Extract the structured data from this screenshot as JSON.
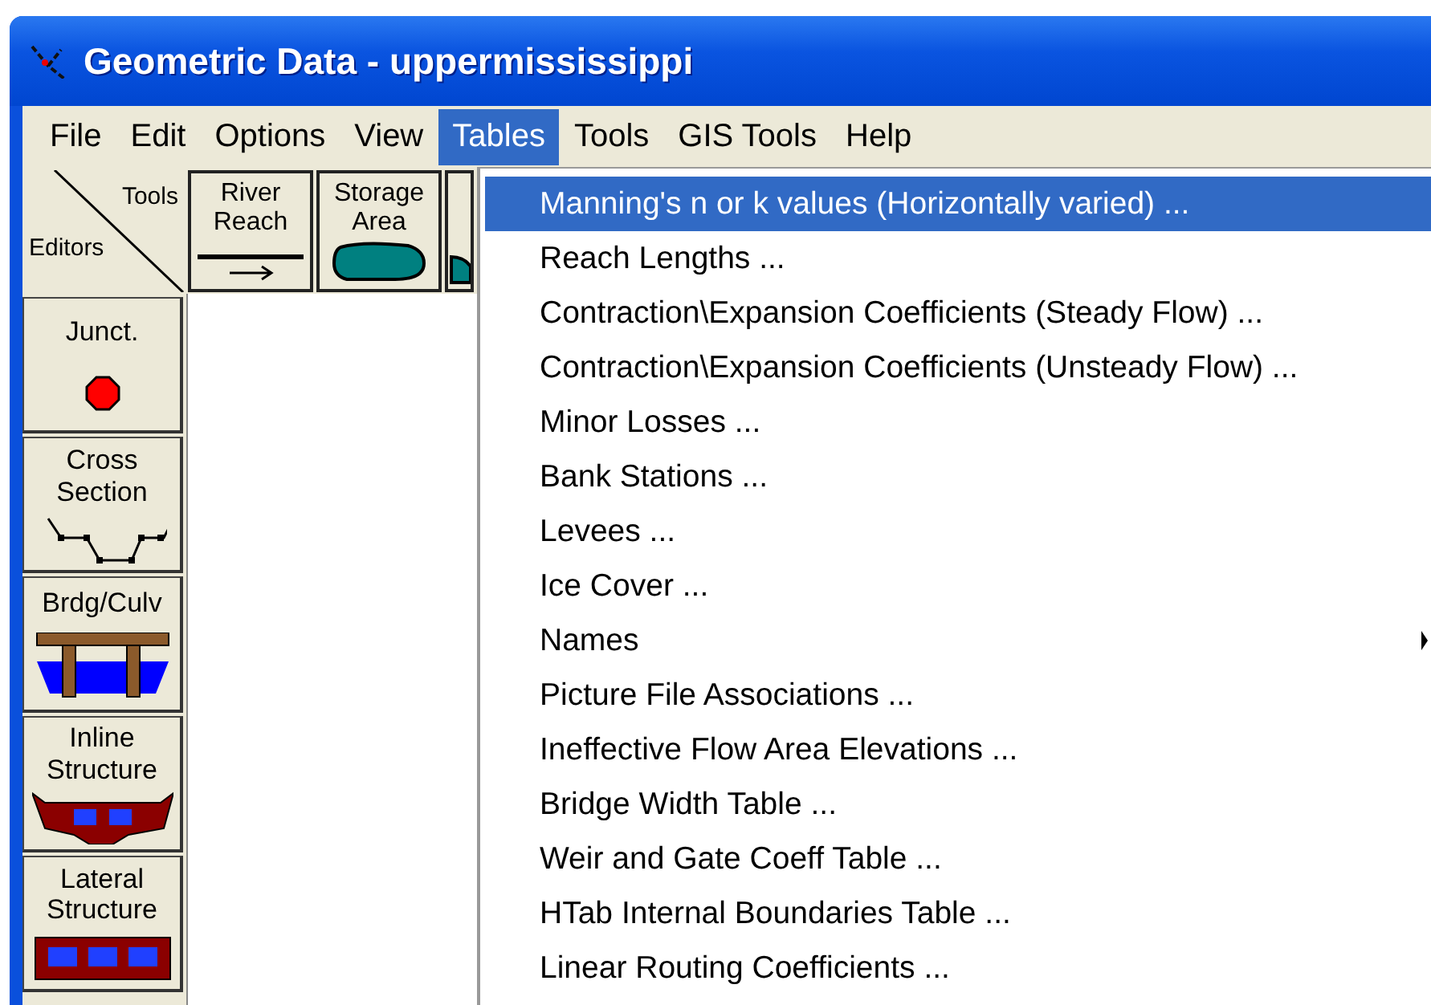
{
  "window": {
    "title": "Geometric Data - uppermississippi"
  },
  "menu_bar": [
    {
      "label": "File",
      "selected": false
    },
    {
      "label": "Edit",
      "selected": false
    },
    {
      "label": "Options",
      "selected": false
    },
    {
      "label": "View",
      "selected": false
    },
    {
      "label": "Tables",
      "selected": true
    },
    {
      "label": "Tools",
      "selected": false
    },
    {
      "label": "GIS Tools",
      "selected": false
    },
    {
      "label": "Help",
      "selected": false
    }
  ],
  "toolbar": {
    "corner": {
      "tools": "Tools",
      "editors": "Editors"
    },
    "tools": [
      {
        "label": "River Reach",
        "kind": "reach"
      },
      {
        "label": "Storage Area",
        "kind": "storage"
      },
      {
        "kind": "partial"
      }
    ]
  },
  "editors": [
    {
      "label": "Junct.",
      "kind": "junction"
    },
    {
      "label": "Cross Section",
      "kind": "cross-section"
    },
    {
      "label": "Brdg/Culv",
      "kind": "bridge"
    },
    {
      "label": "Inline Structure",
      "kind": "inline"
    },
    {
      "label": "Lateral Structure",
      "kind": "lateral"
    }
  ],
  "tables_menu": [
    {
      "label": "Manning's n or k values (Horizontally varied) ...",
      "selected": true
    },
    {
      "label": "Reach Lengths ...",
      "selected": false
    },
    {
      "label": "Contraction\\Expansion Coefficients (Steady Flow) ...",
      "selected": false
    },
    {
      "label": "Contraction\\Expansion Coefficients (Unsteady Flow) ...",
      "selected": false
    },
    {
      "label": "Minor Losses ...",
      "selected": false
    },
    {
      "label": "Bank Stations ...",
      "selected": false
    },
    {
      "label": "Levees ...",
      "selected": false
    },
    {
      "label": "Ice Cover ...",
      "selected": false
    },
    {
      "label": "Names",
      "selected": false,
      "submenu": true
    },
    {
      "label": "Picture File Associations ...",
      "selected": false
    },
    {
      "label": "Ineffective Flow Area Elevations ...",
      "selected": false
    },
    {
      "label": "Bridge Width Table ...",
      "selected": false
    },
    {
      "label": "Weir and Gate Coeff Table ...",
      "selected": false
    },
    {
      "label": "HTab Internal Boundaries Table ...",
      "selected": false
    },
    {
      "label": "Linear Routing Coefficients ...",
      "selected": false
    }
  ]
}
